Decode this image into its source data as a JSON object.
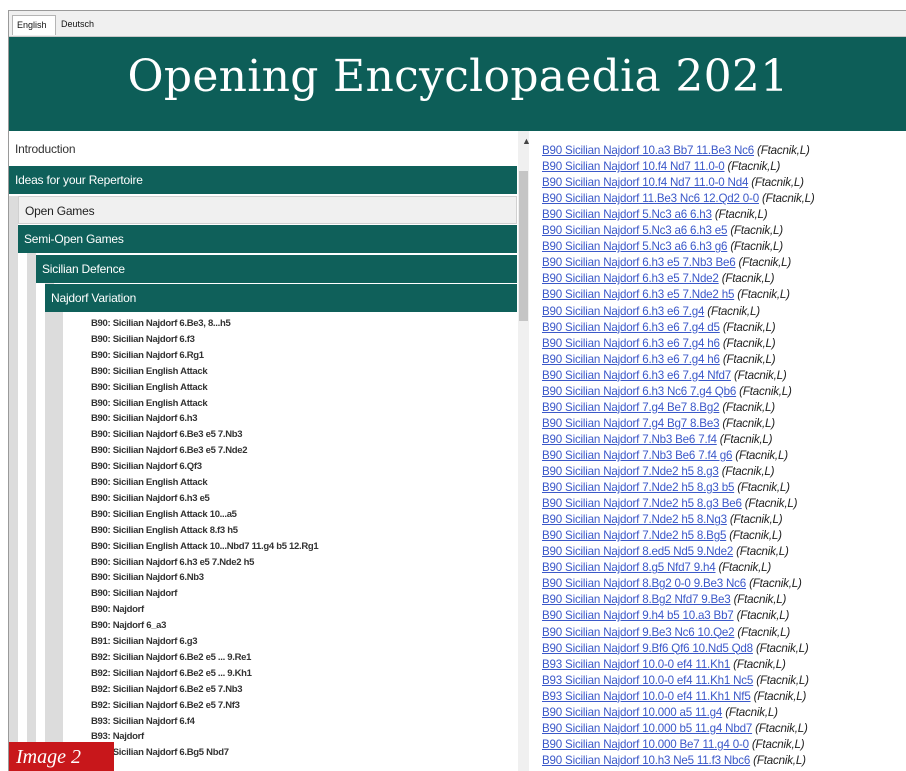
{
  "tabs": [
    {
      "label": "English",
      "active": true
    },
    {
      "label": "Deutsch",
      "active": false
    }
  ],
  "banner": {
    "title": "Opening Encyclopaedia 2021",
    "color": "#0d5e58"
  },
  "tree": {
    "introduction": "Introduction",
    "ideas": "Ideas for your Repertoire",
    "open_games": "Open Games",
    "semi_open": "Semi-Open Games",
    "sicilian": "Sicilian Defence",
    "najdorf": "Najdorf Variation",
    "variations": [
      "B90: Sicilian Najdorf 6.Be3, 8...h5",
      "B90: Sicilian Najdorf 6.f3",
      "B90: Sicilian Najdorf 6.Rg1",
      "B90: Sicilian English Attack",
      "B90: Sicilian English Attack",
      "B90: Sicilian English Attack",
      "B90: Sicilian Najdorf 6.h3",
      "B90: Sicilian Najdorf 6.Be3 e5 7.Nb3",
      "B90: Sicilian Najdorf 6.Be3 e5 7.Nde2",
      "B90: Sicilian Najdorf 6.Qf3",
      "B90: Sicilian English Attack",
      "B90: Sicilian Najdorf 6.h3 e5",
      "B90: Sicilian English Attack 10...a5",
      "B90: Sicilian English Attack 8.f3 h5",
      "B90: Sicilian English Attack 10...Nbd7 11.g4 b5 12.Rg1",
      "B90: Sicilian Najdorf 6.h3 e5 7.Nde2 h5",
      "B90: Sicilian Najdorf 6.Nb3",
      "B90: Sicilian Najdorf",
      "B90: Najdorf",
      "B90: Najdorf 6_a3",
      "B91: Sicilian Najdorf 6.g3",
      "B92: Sicilian Najdorf 6.Be2 e5 ... 9.Re1",
      "B92: Sicilian Najdorf 6.Be2 e5 ... 9.Kh1",
      "B92: Sicilian Najdorf 6.Be2 e5 7.Nb3",
      "B92: Sicilian Najdorf 6.Be2 e5 7.Nf3",
      "B93: Sicilian Najdorf 6.f4",
      "B93: Najdorf",
      "B94: Sicilian Najdorf 6.Bg5 Nbd7"
    ]
  },
  "caption": "Image 2",
  "games": [
    {
      "link": "B90 Sicilian Najdorf 10.a3 Bb7 11.Be3 Nc6",
      "author": "(Ftacnik,L)"
    },
    {
      "link": "B90 Sicilian Najdorf 10.f4 Nd7 11.0-0",
      "author": "(Ftacnik,L)"
    },
    {
      "link": "B90 Sicilian Najdorf 10.f4 Nd7 11.0-0 Nd4",
      "author": "(Ftacnik,L)"
    },
    {
      "link": "B90 Sicilian Najdorf 11.Be3 Nc6 12.Qd2 0-0",
      "author": "(Ftacnik,L)"
    },
    {
      "link": "B90 Sicilian Najdorf 5.Nc3 a6 6.h3",
      "author": "(Ftacnik,L)"
    },
    {
      "link": "B90 Sicilian Najdorf 5.Nc3 a6 6.h3 e5",
      "author": "(Ftacnik,L)"
    },
    {
      "link": "B90 Sicilian Najdorf 5.Nc3 a6 6.h3 g6",
      "author": "(Ftacnik,L)"
    },
    {
      "link": "B90 Sicilian Najdorf 6.h3 e5 7.Nb3 Be6",
      "author": "(Ftacnik,L)"
    },
    {
      "link": "B90 Sicilian Najdorf 6.h3 e5 7.Nde2",
      "author": "(Ftacnik,L)"
    },
    {
      "link": "B90 Sicilian Najdorf 6.h3 e5 7.Nde2 h5",
      "author": "(Ftacnik,L)"
    },
    {
      "link": "B90 Sicilian Najdorf 6.h3 e6 7.g4",
      "author": "(Ftacnik,L)"
    },
    {
      "link": "B90 Sicilian Najdorf 6.h3 e6 7.g4 d5",
      "author": "(Ftacnik,L)"
    },
    {
      "link": "B90 Sicilian Najdorf 6.h3 e6 7.g4 h6",
      "author": "(Ftacnik,L)"
    },
    {
      "link": "B90 Sicilian Najdorf 6.h3 e6 7.g4 h6",
      "author": "(Ftacnik,L)"
    },
    {
      "link": "B90 Sicilian Najdorf 6.h3 e6 7.g4 Nfd7",
      "author": "(Ftacnik,L)"
    },
    {
      "link": "B90 Sicilian Najdorf 6.h3 Nc6 7.g4 Qb6",
      "author": "(Ftacnik,L)"
    },
    {
      "link": "B90 Sicilian Najdorf 7.g4 Be7 8.Bg2",
      "author": "(Ftacnik,L)"
    },
    {
      "link": "B90 Sicilian Najdorf 7.g4 Bg7 8.Be3",
      "author": "(Ftacnik,L)"
    },
    {
      "link": "B90 Sicilian Najdorf 7.Nb3 Be6 7.f4",
      "author": "(Ftacnik,L)"
    },
    {
      "link": "B90 Sicilian Najdorf 7.Nb3 Be6 7.f4 g6",
      "author": "(Ftacnik,L)"
    },
    {
      "link": "B90 Sicilian Najdorf 7.Nde2 h5 8.g3",
      "author": "(Ftacnik,L)"
    },
    {
      "link": "B90 Sicilian Najdorf 7.Nde2 h5 8.g3 b5",
      "author": "(Ftacnik,L)"
    },
    {
      "link": "B90 Sicilian Najdorf 7.Nde2 h5 8.g3 Be6",
      "author": "(Ftacnik,L)"
    },
    {
      "link": "B90 Sicilian Najdorf 7.Nde2 h5 8.Ng3",
      "author": "(Ftacnik,L)"
    },
    {
      "link": "B90 Sicilian Najdorf 7.Nde2 h5 8.Bg5",
      "author": "(Ftacnik,L)"
    },
    {
      "link": "B90 Sicilian Najdorf 8.ed5 Nd5 9.Nde2",
      "author": "(Ftacnik,L)"
    },
    {
      "link": "B90 Sicilian Najdorf 8.g5 Nfd7 9.h4",
      "author": "(Ftacnik,L)"
    },
    {
      "link": "B90 Sicilian Najdorf 8.Bg2 0-0 9.Be3 Nc6",
      "author": "(Ftacnik,L)"
    },
    {
      "link": "B90 Sicilian Najdorf 8.Bg2 Nfd7 9.Be3",
      "author": "(Ftacnik,L)"
    },
    {
      "link": "B90 Sicilian Najdorf 9.h4 b5 10.a3 Bb7",
      "author": "(Ftacnik,L)"
    },
    {
      "link": "B90 Sicilian Najdorf 9.Be3 Nc6 10.Qe2",
      "author": "(Ftacnik,L)"
    },
    {
      "link": "B90 Sicilian Najdorf 9.Bf6 Qf6 10.Nd5 Qd8",
      "author": "(Ftacnik,L)"
    },
    {
      "link": "B93 Sicilian Najdorf 10.0-0 ef4 11.Kh1",
      "author": "(Ftacnik,L)"
    },
    {
      "link": "B93 Sicilian Najdorf 10.0-0 ef4 11.Kh1 Nc5",
      "author": "(Ftacnik,L)"
    },
    {
      "link": "B93 Sicilian Najdorf 10.0-0 ef4 11.Kh1 Nf5",
      "author": "(Ftacnik,L)"
    },
    {
      "link": "B90 Sicilian Najdorf 10.000 a5 11.g4",
      "author": "(Ftacnik,L)"
    },
    {
      "link": "B90 Sicilian Najdorf 10.000 b5 11.g4 Nbd7",
      "author": "(Ftacnik,L)"
    },
    {
      "link": "B90 Sicilian Najdorf 10.000 Be7 11.g4 0-0",
      "author": "(Ftacnik,L)"
    },
    {
      "link": "B90 Sicilian Najdorf 10.h3 Ne5 11.f3 Nbc6",
      "author": "(Ftacnik,L)"
    }
  ]
}
